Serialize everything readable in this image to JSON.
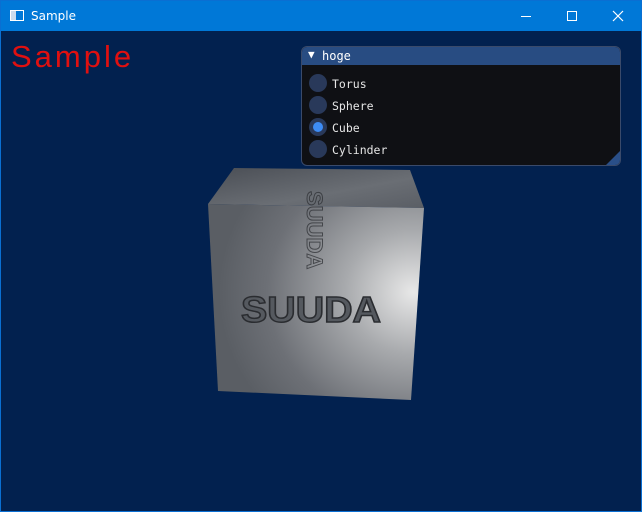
{
  "window": {
    "title": "Sample"
  },
  "overlay": {
    "text": "Sample",
    "color": "#e01010"
  },
  "panel": {
    "title": "hoge",
    "options": [
      {
        "label": "Torus",
        "selected": false
      },
      {
        "label": "Sphere",
        "selected": false
      },
      {
        "label": "Cube",
        "selected": true
      },
      {
        "label": "Cylinder",
        "selected": false
      }
    ]
  },
  "scene": {
    "object": "cube",
    "texture_text": "SUUDA",
    "background": "#02214f"
  },
  "colors": {
    "titlebar": "#0078d7",
    "accent": "#3d8cf5",
    "panel_header": "#284c82"
  }
}
